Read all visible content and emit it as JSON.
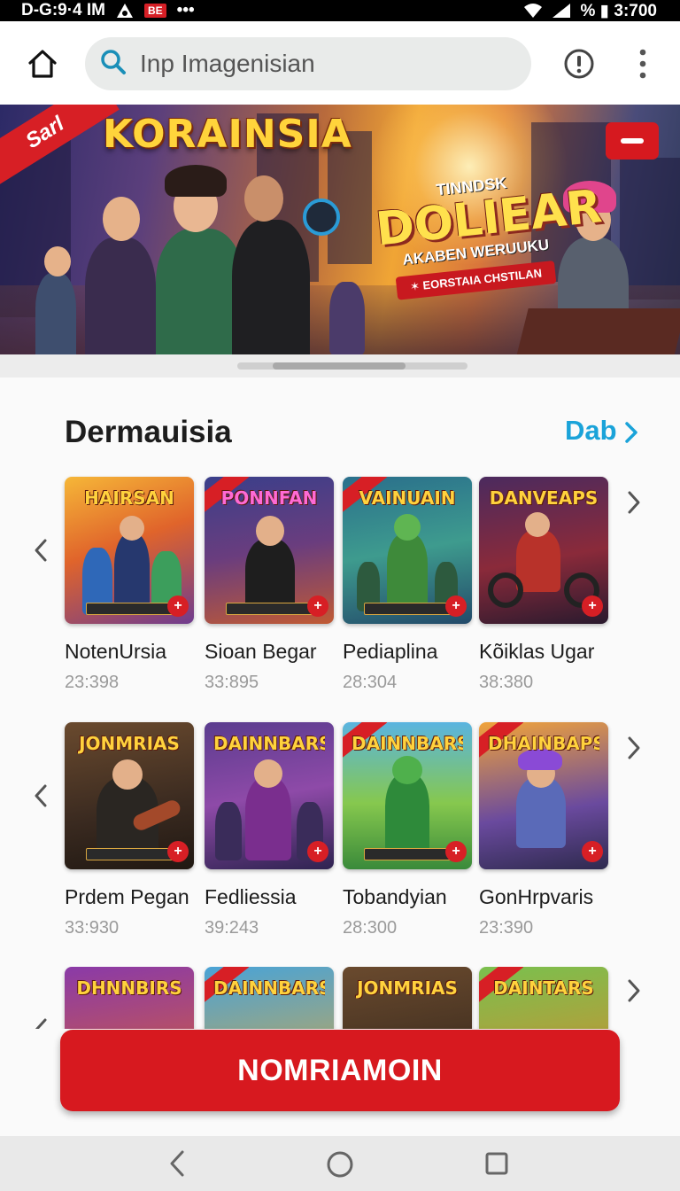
{
  "status_bar": {
    "time": "D-G:9·4 IM",
    "badge": "BE",
    "dots": "•••",
    "right_text": "% ▮ 3:700"
  },
  "toolbar": {
    "home_icon": "home-icon",
    "search_placeholder": "Inp Imagenisian",
    "search_icon": "search-icon",
    "alert_icon": "alert-icon",
    "more_icon": "more-vertical-icon"
  },
  "hero": {
    "ribbon": "Sarl",
    "title": "KORAINSIA",
    "promo_small": "TINNDSK",
    "promo_big": "DOLIEAR",
    "promo_sub": "AKABEN WERUUKU",
    "promo_tag": "✶ EORSTAIA CHSTILAN",
    "close_icon": "minus-icon"
  },
  "section": {
    "title": "Dermauisia",
    "see_all": "Dab",
    "rows": [
      {
        "cards": [
          {
            "banner": "HAIRSAN",
            "name": "NotenUrsia",
            "meta": "23:398"
          },
          {
            "banner": "PONNFAN",
            "name": "Sioan Begar",
            "meta": "33:895"
          },
          {
            "banner": "VAINUAIN",
            "name": "Pediaplina",
            "meta": "28:304"
          },
          {
            "banner": "DANVEAPS",
            "name": "Kõiklas Ugar",
            "meta": "38:380"
          }
        ]
      },
      {
        "cards": [
          {
            "banner": "JONMRIAS",
            "name": "Prdem Pegan",
            "meta": "33:930"
          },
          {
            "banner": "DAINNBARS",
            "name": "Fedliessia",
            "meta": "39:243"
          },
          {
            "banner": "DAINNBARS",
            "name": "Tobandyian",
            "meta": "28:300"
          },
          {
            "banner": "DHAINBAPS",
            "name": "GonHrpvaris",
            "meta": "23:390"
          }
        ]
      },
      {
        "cards": [
          {
            "banner": "DHNNBIRS",
            "name": "",
            "meta": ""
          },
          {
            "banner": "DAINNBARS",
            "name": "",
            "meta": ""
          },
          {
            "banner": "JONMRIAS",
            "name": "",
            "meta": ""
          },
          {
            "banner": "DAINTARS",
            "name": "",
            "meta": ""
          }
        ]
      }
    ]
  },
  "cta": {
    "label": "NOMRIAMOIN"
  },
  "nav_bar": {
    "back_icon": "back-icon",
    "home_icon": "circle-home-icon",
    "recent_icon": "recent-apps-icon"
  },
  "colors": {
    "accent_red": "#d7191f",
    "link_blue": "#1aa3d9",
    "meta_gray": "#9a9a9a"
  }
}
